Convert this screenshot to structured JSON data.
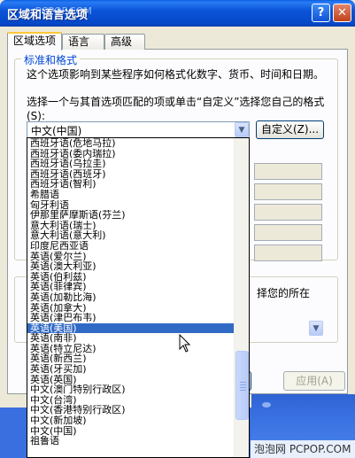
{
  "window": {
    "title": "区域和语言选项",
    "watermark": "PCPOP.COM",
    "help_button": "?",
    "close_button": "✕"
  },
  "tabs": [
    {
      "label": "区域选项",
      "active": true
    },
    {
      "label": "语言",
      "active": false
    },
    {
      "label": "高级",
      "active": false
    }
  ],
  "standards": {
    "group_title": "标准和格式",
    "description": "这个选项影响到某些程序如何格式化数字、货币、时间和日期。",
    "select_prompt": "选择一个与其首选项匹配的项或单击“自定义”选择您自己的格式(S):",
    "selected_value": "中文(中国)",
    "customize_button": "自定义(Z)..."
  },
  "location": {
    "text": "择您的所在"
  },
  "buttons": {
    "apply": "应用(A)"
  },
  "dropdown": {
    "items": [
      "西班牙语(危地马拉)",
      "西班牙语(委内瑞拉)",
      "西班牙语(乌拉圭)",
      "西班牙语(西班牙)",
      "西班牙语(智利)",
      "希腊语",
      "匈牙利语",
      "伊那里萨摩斯语(芬兰)",
      "意大利语(瑞士)",
      "意大利语(意大利)",
      "印度尼西亚语",
      "英语(爱尔兰)",
      "英语(澳大利亚)",
      "英语(伯利兹)",
      "英语(菲律宾)",
      "英语(加勒比海)",
      "英语(加拿大)",
      "英语(津巴布韦)",
      "英语(美国)",
      "英语(南非)",
      "英语(特立尼达)",
      "英语(新西兰)",
      "英语(牙买加)",
      "英语(英国)",
      "中文(澳门特别行政区)",
      "中文(台湾)",
      "中文(香港特别行政区)",
      "中文(新加坡)",
      "中文(中国)",
      "祖鲁语"
    ],
    "selected_index": 18,
    "scroll_position": 0.85
  },
  "footer": {
    "watermark": "泡泡网 PCPOP.COM"
  },
  "colors": {
    "titlebar": "#0a54d9",
    "selection": "#316ac5",
    "group_title": "#0046d5",
    "dialog_bg": "#ece9d8"
  }
}
